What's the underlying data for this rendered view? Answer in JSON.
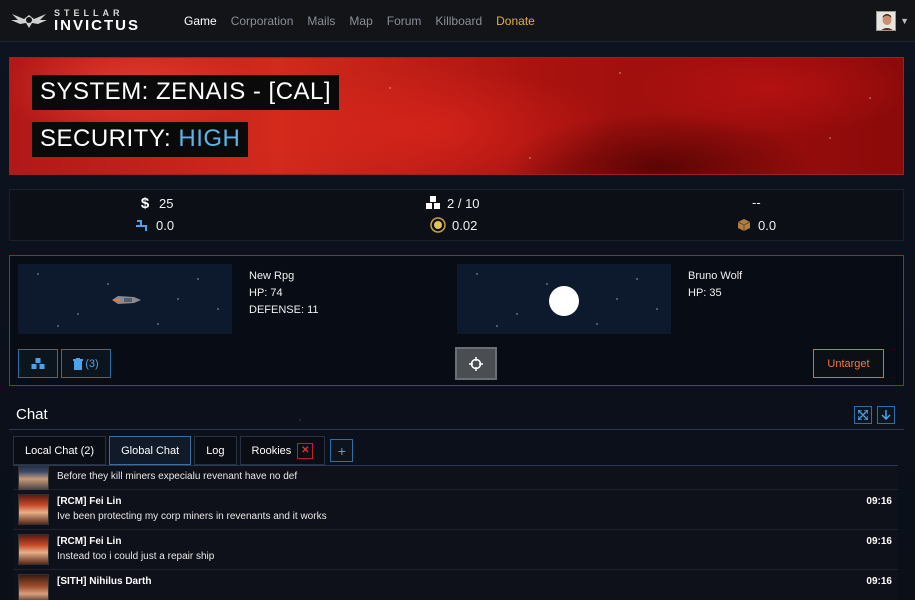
{
  "nav": {
    "logo_top": "STELLAR",
    "logo_bottom": "INVICTUS",
    "links": [
      "Game",
      "Corporation",
      "Mails",
      "Map",
      "Forum",
      "Killboard",
      "Donate"
    ]
  },
  "system": {
    "name_line": "SYSTEM: ZENAIS - [CAL]",
    "security_label": "SECURITY:",
    "security_value": "HIGH"
  },
  "stats": {
    "credits": "25",
    "stat_a": "0.0",
    "cargo": "2 / 10",
    "stat_b": "0.02",
    "stat_c": "--",
    "stat_d": "0.0"
  },
  "target": {
    "self": {
      "name": "New Rpg",
      "hp": "HP: 74",
      "defense": "DEFENSE: 11"
    },
    "other": {
      "name": "Bruno Wolf",
      "hp": "HP: 35"
    },
    "drones_label": "(3)",
    "untarget_label": "Untarget"
  },
  "chat": {
    "title": "Chat",
    "tabs": [
      "Local Chat (2)",
      "Global Chat",
      "Log",
      "Rookies"
    ],
    "active_tab": "Global Chat",
    "messages": [
      {
        "name": "",
        "time": "",
        "text": "Before they kill miners expecialu revenant have no def"
      },
      {
        "name": "[RCM] Fei Lin",
        "time": "09:16",
        "text": "Ive been protecting my corp miners in revenants and it works"
      },
      {
        "name": "[RCM] Fei Lin",
        "time": "09:16",
        "text": "Instead too i could just a repair ship"
      },
      {
        "name": "[SITH] Nihilus Darth",
        "time": "09:16",
        "text": ""
      }
    ]
  },
  "colors": {
    "accent_blue": "#4ea3e8",
    "security_high": "#5ab4e8",
    "danger_red": "#b02020",
    "untarget_orange": "#ef7a48",
    "donate_gold": "#e0b040"
  }
}
